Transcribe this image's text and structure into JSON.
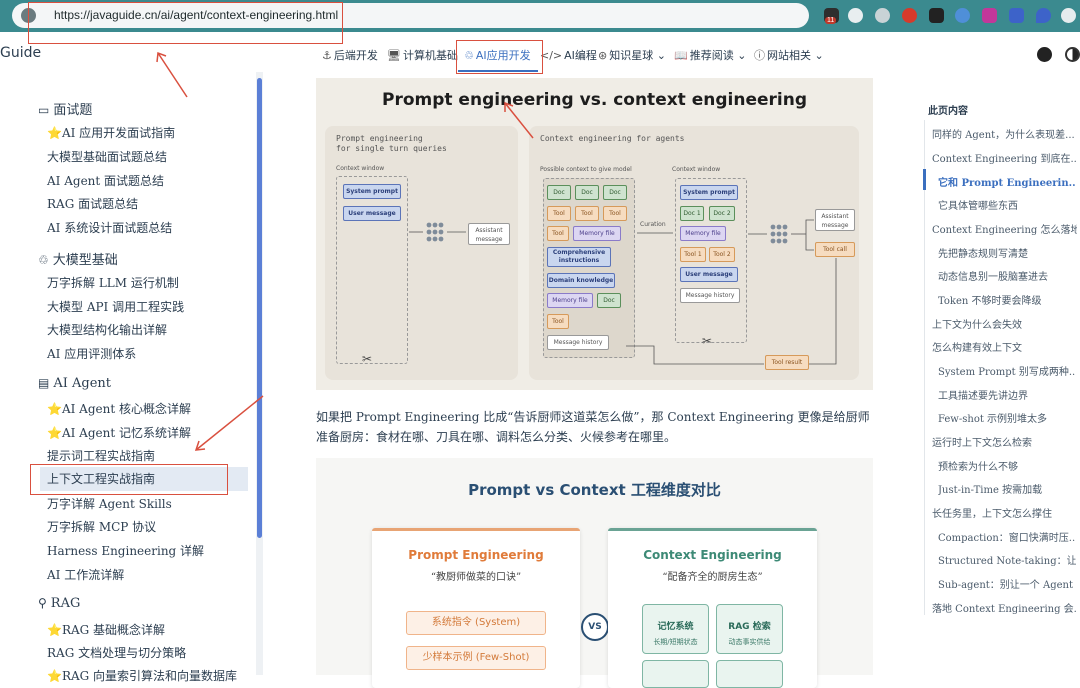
{
  "browser": {
    "url": "https://javaguide.cn/ai/agent/context-engineering.html",
    "extension_badge": "11"
  },
  "brand": "Guide",
  "nav": [
    {
      "icon": "⚓",
      "label": "后端开发"
    },
    {
      "icon": "🖥",
      "label": "计算机基础"
    },
    {
      "icon": "♲",
      "label": "AI应用开发"
    },
    {
      "icon": "</>",
      "label": "AI编程"
    },
    {
      "icon": "⊛",
      "label": "知识星球 ⌄"
    },
    {
      "icon": "📖",
      "label": "推荐阅读 ⌄"
    },
    {
      "icon": "ⓘ",
      "label": "网站相关 ⌄"
    }
  ],
  "sidebar": {
    "sections": [
      {
        "icon": "▭",
        "title": "面试题",
        "items": [
          "⭐AI 应用开发面试指南",
          "大模型基础面试题总结",
          "AI Agent 面试题总结",
          "RAG 面试题总结",
          "AI 系统设计面试题总结"
        ]
      },
      {
        "icon": "♲",
        "title": "大模型基础",
        "items": [
          "万字拆解 LLM 运行机制",
          "大模型 API 调用工程实践",
          "大模型结构化输出详解",
          "AI 应用评测体系"
        ]
      },
      {
        "icon": "▤",
        "title": "AI Agent",
        "items": [
          "⭐AI Agent 核心概念详解",
          "⭐AI Agent 记忆系统详解",
          "提示词工程实战指南",
          "上下文工程实战指南",
          "万字详解 Agent Skills",
          "万字拆解 MCP 协议",
          "Harness Engineering 详解",
          "AI 工作流详解"
        ]
      },
      {
        "icon": "⚲",
        "title": "RAG",
        "items": [
          "⭐RAG 基础概念详解",
          "RAG 文档处理与切分策略",
          "⭐RAG 向量索引算法和向量数据库"
        ]
      }
    ]
  },
  "hero": {
    "title": "Prompt engineering vs. context engineering",
    "left_panel_title": "Prompt engineering\nfor single turn queries",
    "left_cw": "Context window",
    "left_chips": [
      "System prompt",
      "User message"
    ],
    "assistant": "Assistant\nmessage",
    "right_panel_title": "Context engineering for agents",
    "possible_label": "Possible context to give model",
    "right_cw": "Context window",
    "curation": "Curation",
    "pool": [
      "Doc",
      "Doc",
      "Doc",
      "Tool",
      "Tool",
      "Tool",
      "Tool",
      "Memory file",
      "Comprehensive instructions",
      "Domain knowledge",
      "Memory file",
      "Doc",
      "Tool",
      "Message history"
    ],
    "window": [
      "System prompt",
      "Doc 1",
      "Doc 2",
      "Memory file",
      "Tool 1",
      "Tool 2",
      "User message",
      "Message history"
    ],
    "assistant2": "Assistant\nmessage",
    "tool_call": "Tool call",
    "tool_result": "Tool result"
  },
  "paragraph": "如果把 Prompt Engineering 比成“告诉厨师这道菜怎么做”，那 Context Engineering 更像是给厨师准备厨房：食材在哪、刀具在哪、调料怎么分类、火候参考在哪里。",
  "compare": {
    "title": "Prompt vs Context 工程维度对比",
    "prompt_title": "Prompt Engineering",
    "prompt_sub": "“教厨师做菜的口诀”",
    "prompt_items": [
      "系统指令 (System)",
      "少样本示例 (Few-Shot)"
    ],
    "vs": "VS",
    "context_title": "Context Engineering",
    "context_sub": "“配备齐全的厨房生态”",
    "context_items": [
      {
        "t": "记忆系统",
        "s": "长期/短期状态"
      },
      {
        "t": "RAG 检索",
        "s": "动态事实供给"
      }
    ]
  },
  "toc": {
    "title": "此页内容",
    "items": [
      {
        "label": "同样的 Agent，为什么表现差...",
        "level": 1
      },
      {
        "label": "Context Engineering 到底在...",
        "level": 1
      },
      {
        "label": "它和 Prompt Engineerin...",
        "level": 2
      },
      {
        "label": "它具体管哪些东西",
        "level": 2
      },
      {
        "label": "Context Engineering 怎么落地",
        "level": 1
      },
      {
        "label": "先把静态规则写清楚",
        "level": 2
      },
      {
        "label": "动态信息别一股脑塞进去",
        "level": 2
      },
      {
        "label": "Token 不够时要会降级",
        "level": 2
      },
      {
        "label": "上下文为什么会失效",
        "level": 1
      },
      {
        "label": "怎么构建有效上下文",
        "level": 1
      },
      {
        "label": "System Prompt 别写成两种...",
        "level": 2
      },
      {
        "label": "工具描述要先讲边界",
        "level": 2
      },
      {
        "label": "Few-shot 示例别堆太多",
        "level": 2
      },
      {
        "label": "运行时上下文怎么检索",
        "level": 1
      },
      {
        "label": "预检索为什么不够",
        "level": 2
      },
      {
        "label": "Just-in-Time 按需加载",
        "level": 2
      },
      {
        "label": "长任务里，上下文怎么撑住",
        "level": 1
      },
      {
        "label": "Compaction：窗口快满时压...",
        "level": 2
      },
      {
        "label": "Structured Note-taking：让 ...",
        "level": 2
      },
      {
        "label": "Sub-agent：别让一个 Agent ...",
        "level": 2
      },
      {
        "label": "落地 Context Engineering 会...",
        "level": 1
      }
    ]
  },
  "colors": {
    "accent": "#3b6fbf",
    "annotation": "#d9503f",
    "chrome": "#3b8a8f"
  }
}
